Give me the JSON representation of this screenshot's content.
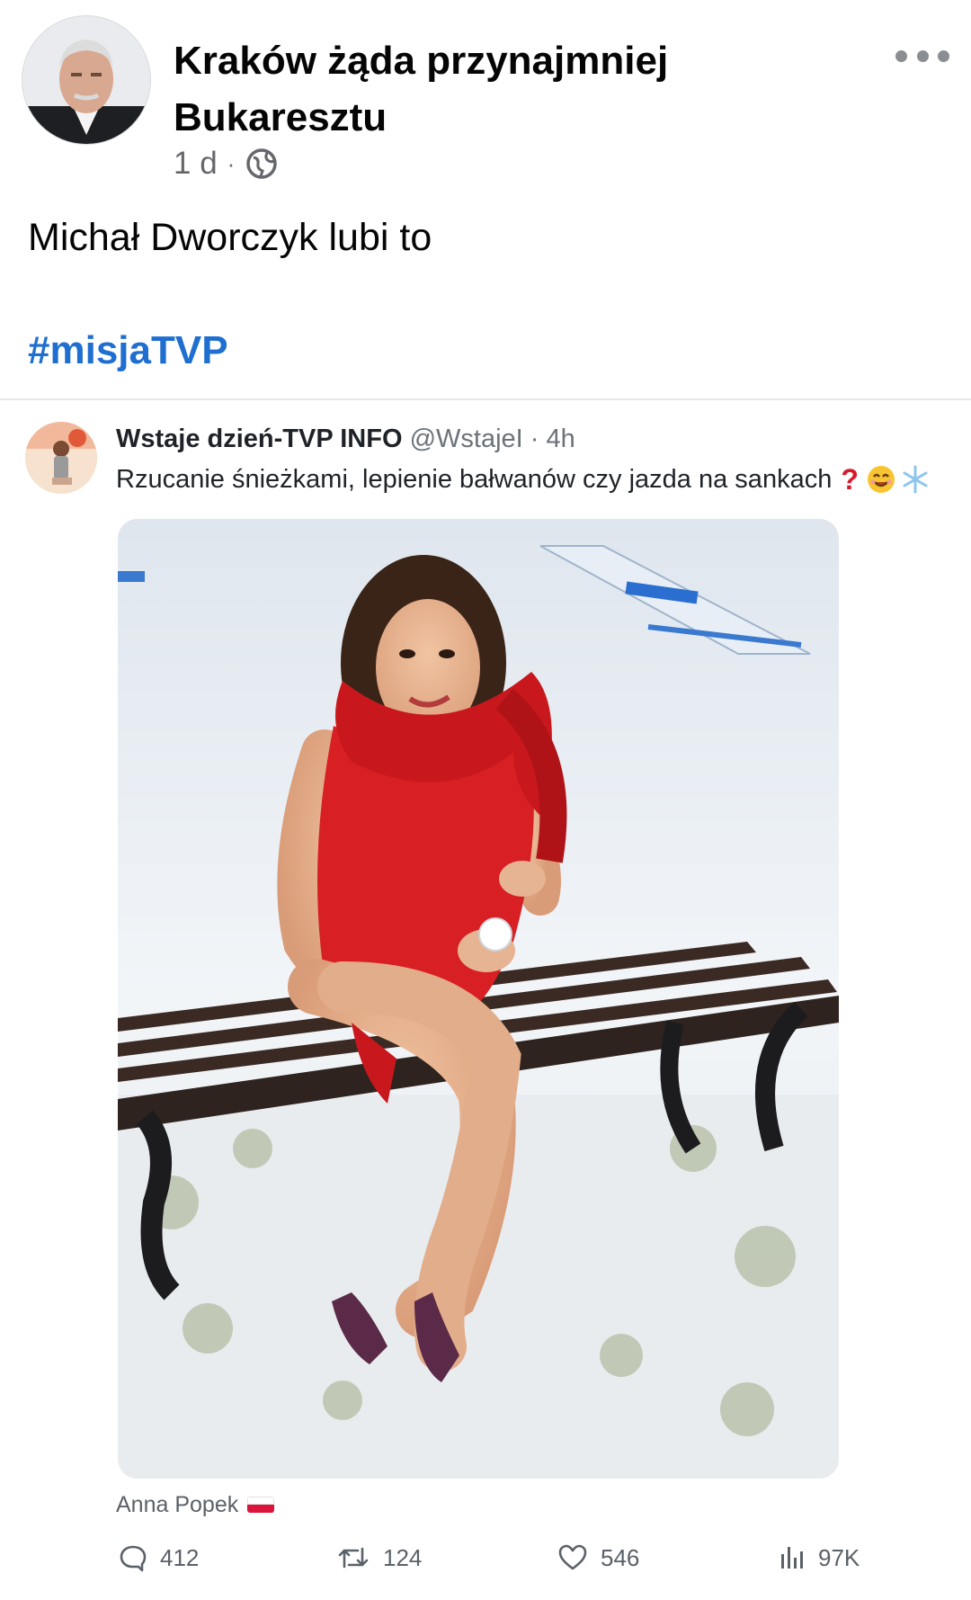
{
  "post": {
    "title": "Kraków żąda przynajmniej Bukaresztu",
    "time": "1 d",
    "separator": "·",
    "text": "Michał Dworczyk lubi to",
    "hashtag": "#misjaTVP"
  },
  "tweet": {
    "name": "Wstaje dzień-TVP INFO",
    "handle": "@WstajeI",
    "separator": " · ",
    "time": "4h",
    "text": "Rzucanie śnieżkami, lepienie bałwanów czy jazda na sankach",
    "photo_caption": "Anna Popek",
    "stats": {
      "replies": "412",
      "reposts": "124",
      "likes": "546",
      "views": "97K"
    }
  },
  "icons": {
    "visibility": "globe-icon",
    "menu": "more-horizontal-icon",
    "reply": "comment-icon",
    "repost": "retweet-icon",
    "like": "heart-icon",
    "views": "bar-chart-icon"
  },
  "colors": {
    "hashtag": "#1f6fd1",
    "secondary_text": "#65676b"
  }
}
